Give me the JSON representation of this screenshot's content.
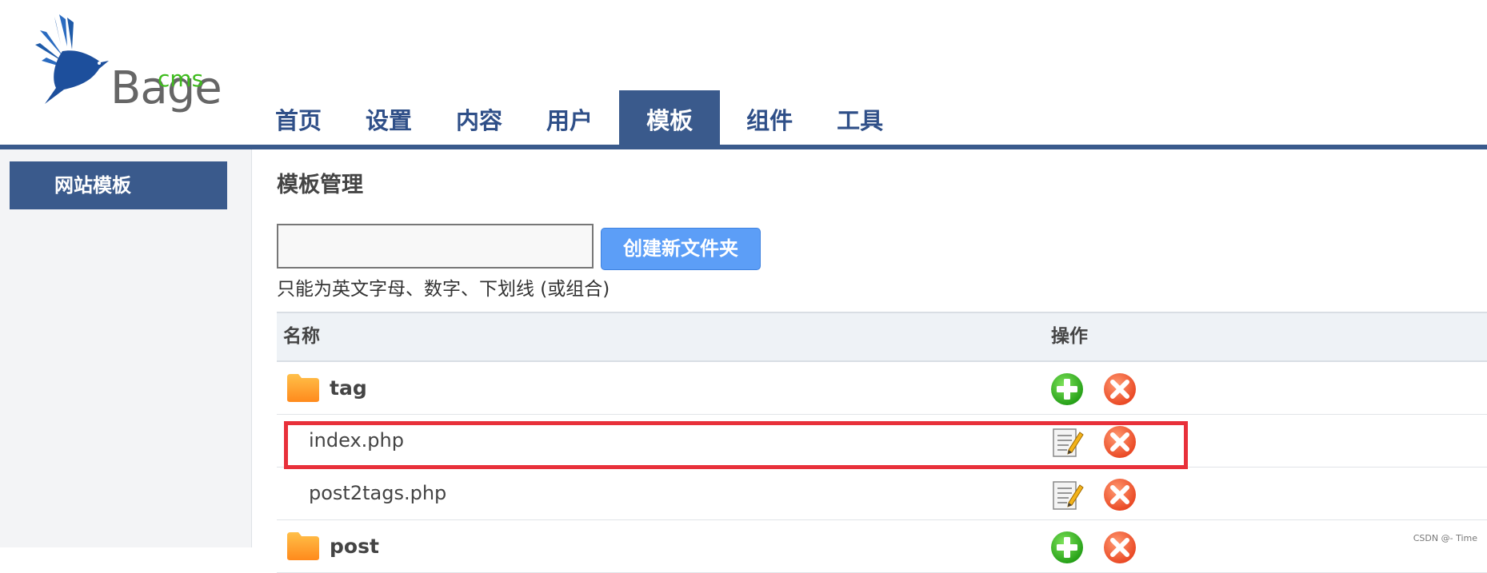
{
  "logo": {
    "brand": "Bage",
    "suffix": "cms"
  },
  "nav": {
    "items": [
      {
        "label": "首页"
      },
      {
        "label": "设置"
      },
      {
        "label": "内容"
      },
      {
        "label": "用户"
      },
      {
        "label": "模板",
        "active": true
      },
      {
        "label": "组件"
      },
      {
        "label": "工具"
      }
    ]
  },
  "sidebar": {
    "items": [
      {
        "label": "网站模板",
        "active": true
      }
    ]
  },
  "main": {
    "title": "模板管理",
    "folder_input": {
      "value": "",
      "placeholder": ""
    },
    "create_button": "创建新文件夹",
    "hint": "只能为英文字母、数字、下划线 (或组合)",
    "table": {
      "headers": {
        "name": "名称",
        "ops": "操作"
      },
      "rows": [
        {
          "type": "folder",
          "name": "tag"
        },
        {
          "type": "file",
          "name": "index.php"
        },
        {
          "type": "file",
          "name": "post2tags.php"
        },
        {
          "type": "folder",
          "name": "post"
        }
      ]
    }
  },
  "watermark": "CSDN @- Time",
  "colors": {
    "primary": "#3a5a8c",
    "button": "#5c9ef7",
    "highlight": "#e8303a",
    "add": "#3dbb1c",
    "delete": "#f05a3a"
  }
}
